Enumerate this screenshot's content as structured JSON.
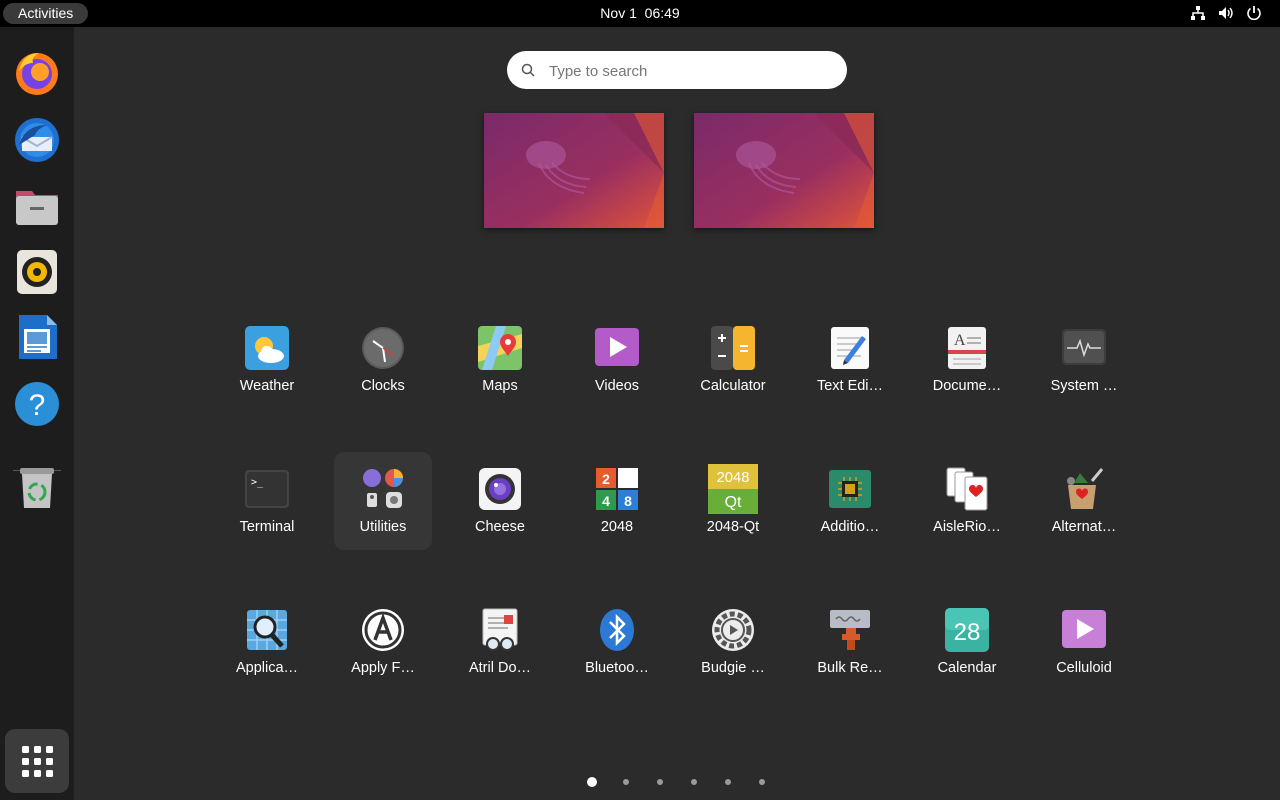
{
  "topbar": {
    "activities_label": "Activities",
    "date": "Nov 1",
    "time": "06:49",
    "tray_icons": [
      "network-icon",
      "volume-icon",
      "power-icon"
    ]
  },
  "dock": {
    "items": [
      "firefox",
      "thunderbird",
      "files",
      "rhythmbox",
      "libreoffice-writer",
      "help",
      "trash"
    ],
    "show_apps": "show-applications"
  },
  "search": {
    "placeholder": "Type to search"
  },
  "apps": [
    {
      "label": "Weather"
    },
    {
      "label": "Clocks"
    },
    {
      "label": "Maps"
    },
    {
      "label": "Videos"
    },
    {
      "label": "Calculator"
    },
    {
      "label": "Text Edi…"
    },
    {
      "label": "Docume…"
    },
    {
      "label": "System …"
    },
    {
      "label": "Terminal"
    },
    {
      "label": "Utilities"
    },
    {
      "label": "Cheese"
    },
    {
      "label": "2048"
    },
    {
      "label": "2048-Qt"
    },
    {
      "label": "Additio…"
    },
    {
      "label": "AisleRio…"
    },
    {
      "label": "Alternat…"
    },
    {
      "label": "Applica…"
    },
    {
      "label": "Apply F…"
    },
    {
      "label": "Atril Do…"
    },
    {
      "label": "Bluetoo…"
    },
    {
      "label": "Budgie …"
    },
    {
      "label": "Bulk Re…"
    },
    {
      "label": "Calendar"
    },
    {
      "label": "Celluloid"
    }
  ],
  "icon_text": {
    "terminal": ">_",
    "twenty48": [
      "2",
      "4",
      "8"
    ],
    "qt2048_top": "2048",
    "qt2048_bottom": "Qt",
    "calendar_day": "28"
  },
  "pager": {
    "pages": 6,
    "current": 1
  }
}
